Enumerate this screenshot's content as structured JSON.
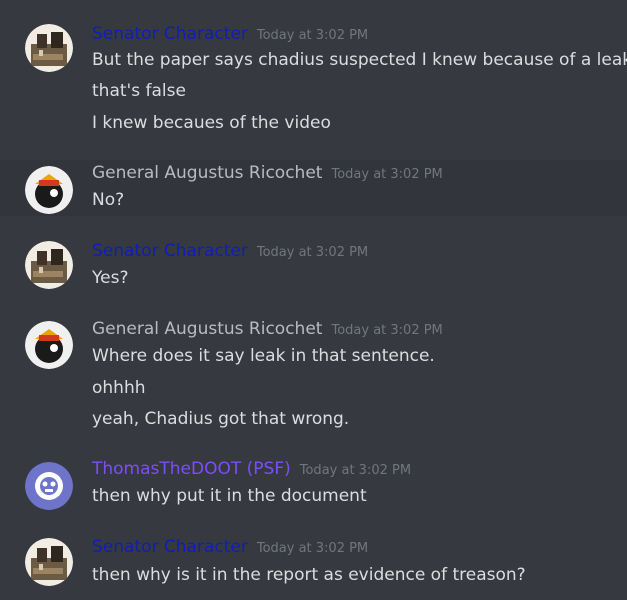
{
  "colors": {
    "senator_name": "#0f1fb4",
    "general_name": "#b9bbbe",
    "thomas_name": "#7c4dff",
    "background": "#36393f",
    "hover_background": "#32353b",
    "text": "#dcddde",
    "timestamp": "#72767d"
  },
  "messages": [
    {
      "author": "Senator Character",
      "timestamp": "Today at 3:02 PM",
      "avatar_icon": "senator-avatar-icon",
      "lines": [
        "But the paper says chadius suspected I knew because of a leak",
        "that's false",
        "I knew becaues of the video"
      ]
    },
    {
      "author": "General Augustus Ricochet",
      "timestamp": "Today at 3:02 PM",
      "avatar_icon": "general-avatar-icon",
      "lines": [
        "No?"
      ]
    },
    {
      "author": "Senator Character",
      "timestamp": "Today at 3:02 PM",
      "avatar_icon": "senator-avatar-icon",
      "lines": [
        "Yes?"
      ]
    },
    {
      "author": "General Augustus Ricochet",
      "timestamp": "Today at 3:02 PM",
      "avatar_icon": "general-avatar-icon",
      "lines": [
        "Where does it say leak in that sentence.",
        "ohhhh",
        "yeah, Chadius got that wrong."
      ]
    },
    {
      "author": "ThomasTheDOOT (PSF)",
      "timestamp": "Today at 3:02 PM",
      "avatar_icon": "thomas-avatar-icon",
      "lines": [
        "then why put it in the document"
      ]
    },
    {
      "author": "Senator Character",
      "timestamp": "Today at 3:02 PM",
      "avatar_icon": "senator-avatar-icon",
      "lines": [
        "then why is it in the report as evidence of treason?"
      ]
    }
  ]
}
